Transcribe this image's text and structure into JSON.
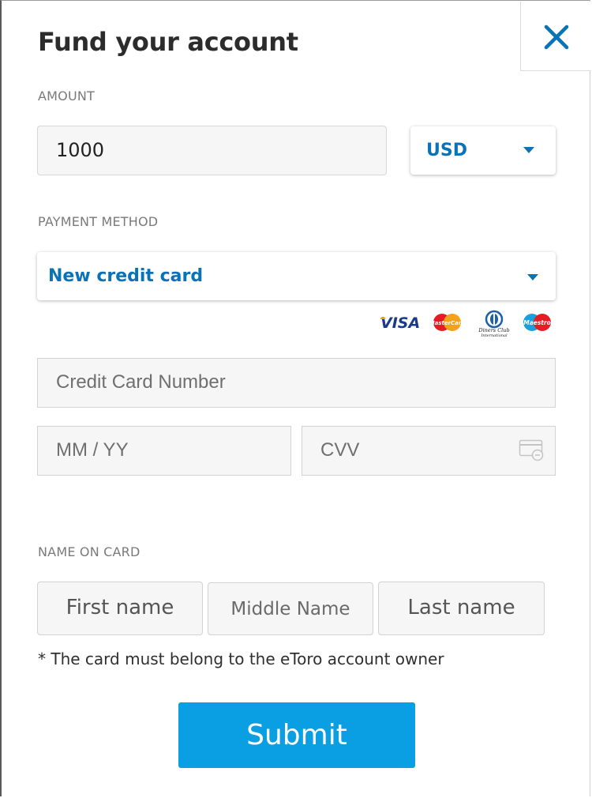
{
  "dialog": {
    "title": "Fund your account",
    "close_icon": "close-icon"
  },
  "amount": {
    "label": "AMOUNT",
    "value": "1000",
    "currency": "USD"
  },
  "payment": {
    "label": "PAYMENT METHOD",
    "selected": "New credit card",
    "card_logos": [
      "VISA",
      "MasterCard",
      "Diners Club International",
      "Maestro"
    ]
  },
  "card": {
    "number_placeholder": "Credit Card Number",
    "expiry_placeholder": "MM / YY",
    "cvv_placeholder": "CVV"
  },
  "name": {
    "label": "NAME ON CARD",
    "first_placeholder": "First name",
    "middle_placeholder": "Middle Name",
    "last_placeholder": "Last name"
  },
  "note": "* The card must belong to the eToro account owner",
  "submit_label": "Submit",
  "colors": {
    "accent": "#0a73b8",
    "button": "#0a9ee3",
    "field_bg": "#f6f6f6"
  }
}
